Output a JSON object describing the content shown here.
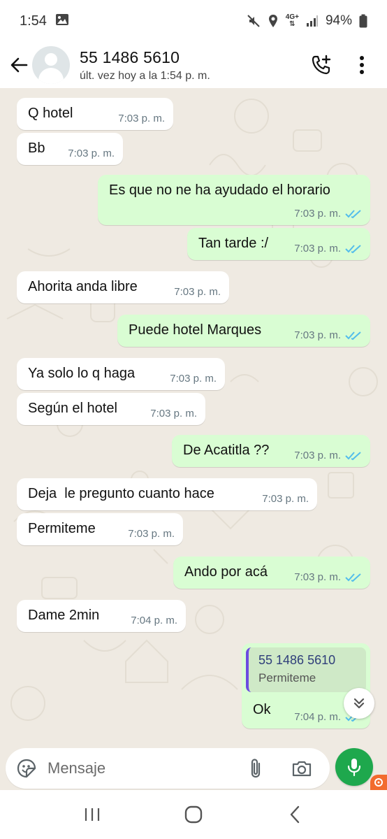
{
  "status_bar": {
    "time": "1:54",
    "battery": "94%",
    "network": "4G+"
  },
  "header": {
    "contact_name": "55 1486 5610",
    "last_seen": "últ. vez hoy a la 1:54 p. m."
  },
  "messages": [
    {
      "direction": "in",
      "text": "Q hotel",
      "time": "7:03 p. m."
    },
    {
      "direction": "in",
      "text": "Bb",
      "time": "7:03 p. m."
    },
    {
      "direction": "out",
      "text": "Es que no ne ha ayudado el horario",
      "time": "7:03 p. m.",
      "read": true
    },
    {
      "direction": "out",
      "text": "Tan tarde :/",
      "time": "7:03 p. m.",
      "read": true
    },
    {
      "direction": "in",
      "text": "Ahorita anda libre",
      "time": "7:03 p. m."
    },
    {
      "direction": "out",
      "text": "Puede hotel Marques",
      "time": "7:03 p. m.",
      "read": true
    },
    {
      "direction": "in",
      "text": "Ya solo lo q haga",
      "time": "7:03 p. m."
    },
    {
      "direction": "in",
      "text": "Según el hotel",
      "time": "7:03 p. m."
    },
    {
      "direction": "out",
      "text": "De Acatitla ??",
      "time": "7:03 p. m.",
      "read": true
    },
    {
      "direction": "in",
      "text": "Deja  le pregunto cuanto hace",
      "time": "7:03 p. m."
    },
    {
      "direction": "in",
      "text": "Permiteme",
      "time": "7:03 p. m."
    },
    {
      "direction": "out",
      "text": "Ando por acá",
      "time": "7:03 p. m.",
      "read": true
    },
    {
      "direction": "in",
      "text": "Dame 2min",
      "time": "7:04 p. m."
    },
    {
      "direction": "out",
      "text": "Ok",
      "time": "7:04 p. m.",
      "read": true,
      "quote": {
        "name": "55 1486 5610",
        "text": "Permiteme"
      }
    }
  ],
  "composer": {
    "placeholder": "Mensaje"
  },
  "icons": {
    "back": "arrow-left-icon",
    "add_call": "phone-plus-icon",
    "menu": "more-vert-icon",
    "emoji": "sticker-icon",
    "attach": "paperclip-icon",
    "camera": "camera-icon",
    "mic": "mic-icon",
    "scroll_down": "double-chevron-down-icon"
  },
  "colors": {
    "accent": "#1ea84d",
    "outgoing_bubble": "#d9fdd3",
    "incoming_bubble": "#ffffff",
    "chat_bg": "#efeae2",
    "read_ticks": "#53bdeb"
  }
}
